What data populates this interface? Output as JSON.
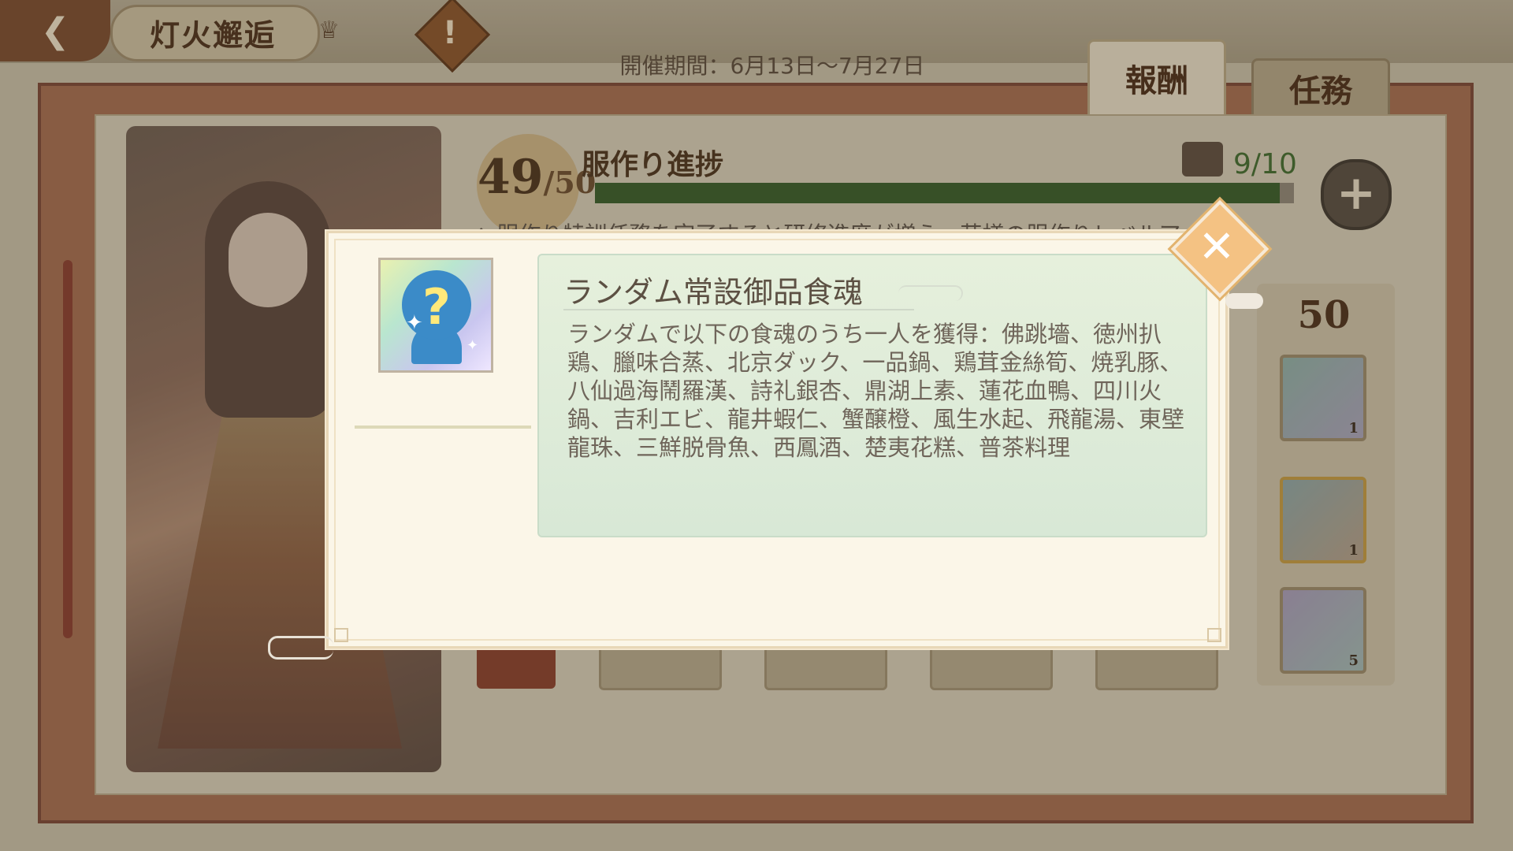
{
  "header": {
    "event_title": "灯火邂逅",
    "period_text": "開催期間：6月13日〜7月27日"
  },
  "tabs": [
    {
      "label": "報酬"
    },
    {
      "label": "任務"
    }
  ],
  "progress": {
    "label": "服作り進捗",
    "current": "49",
    "max_text": "/50",
    "fraction": 0.98,
    "chest_count": "9/10",
    "hint": "◆ 服作り特訓任務を完了すると研修進度が増え、芸様の服作りレベルアップ！"
  },
  "side_rewards": {
    "tier": "50",
    "items": [
      {
        "icon": "random-food-soul-icon",
        "count": "1"
      },
      {
        "icon": "chibi-character-icon",
        "count": "1"
      },
      {
        "icon": "red-spirit-icon",
        "count": "5"
      }
    ]
  },
  "modal": {
    "item_icon": "random-food-soul-icon",
    "item_name": "ランダム常設御品食魂",
    "item_desc": "ランダムで以下の食魂のうち一人を獲得：佛跳墻、徳州扒鶏、臘味合蒸、北京ダック、一品鍋、鶏茸金絲筍、焼乳豚、八仙過海鬧羅漢、詩礼銀杏、鼎湖上素、蓮花血鴨、四川火鍋、吉利エビ、龍井蝦仁、蟹醸橙、風生水起、飛龍湯、東壁龍珠、三鮮脱骨魚、西鳳酒、楚夷花糕、普茶料理",
    "close_icon": "close-icon"
  },
  "colors": {
    "modal_bg": "#fbf6e8",
    "desc_panel": "#e0eddb",
    "close_button": "#f4c283",
    "progress_fill": "#355a24"
  }
}
